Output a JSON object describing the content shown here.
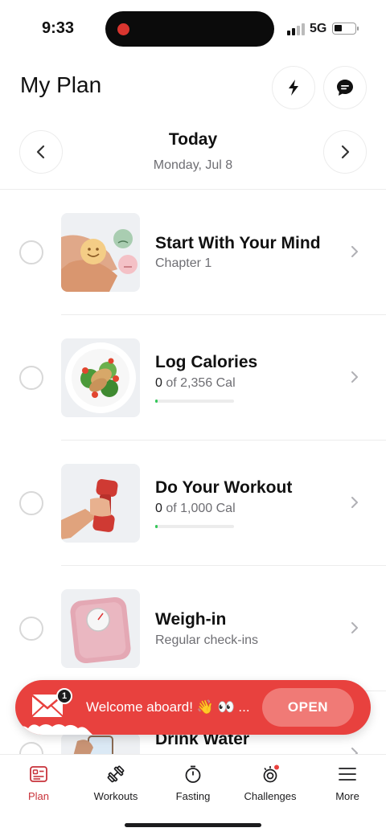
{
  "status_bar": {
    "time": "9:33",
    "network": "5G"
  },
  "header": {
    "title": "My Plan",
    "bolt_icon": "bolt-icon",
    "chat_icon": "chat-bubble-icon"
  },
  "date_nav": {
    "title": "Today",
    "subtitle": "Monday, Jul 8"
  },
  "tasks": [
    {
      "title": "Start With Your Mind",
      "subtitle": "Chapter 1",
      "image": "hands-emoji-faces"
    },
    {
      "title": "Log Calories",
      "value": "0",
      "rest": " of 2,356 Cal",
      "progress": 0.03,
      "image": "salad-plate"
    },
    {
      "title": "Do Your Workout",
      "value": "0",
      "rest": " of 1,000 Cal",
      "progress": 0.03,
      "image": "dumbbell-hand"
    },
    {
      "title": "Weigh-in",
      "subtitle": "Regular check-ins",
      "image": "bathroom-scale"
    },
    {
      "title": "Drink Water",
      "image": "water-glass"
    }
  ],
  "toast": {
    "message": "Welcome aboard! 👋 👀 ...",
    "button": "OPEN",
    "badge_count": "1",
    "icon": "envelope-icon"
  },
  "tab_bar": [
    {
      "label": "Plan",
      "icon": "plan-icon",
      "active": true
    },
    {
      "label": "Workouts",
      "icon": "dumbbell-icon"
    },
    {
      "label": "Fasting",
      "icon": "stopwatch-icon"
    },
    {
      "label": "Challenges",
      "icon": "challenges-icon"
    },
    {
      "label": "More",
      "icon": "menu-icon"
    }
  ],
  "colors": {
    "accent": "#e8413e",
    "active_tab": "#c8323a",
    "progress": "#34c759"
  }
}
